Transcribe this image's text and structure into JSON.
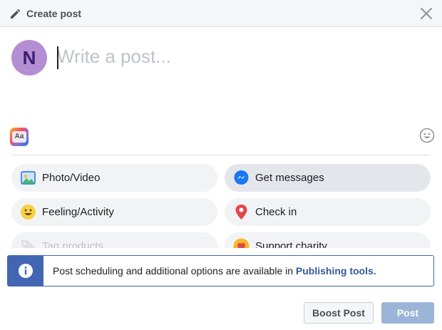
{
  "header": {
    "title": "Create post",
    "icons": {
      "left": "pencil-icon",
      "right": "close-icon"
    }
  },
  "composer": {
    "avatar_initial": "N",
    "placeholder": "Write a post...",
    "value": "",
    "icons": {
      "style": "text-background-icon",
      "emoji": "emoji-icon"
    }
  },
  "options": [
    {
      "label": "Photo/Video",
      "icon": "photo-video-icon"
    },
    {
      "label": "Get messages",
      "icon": "messenger-icon"
    },
    {
      "label": "Feeling/Activity",
      "icon": "feeling-icon"
    },
    {
      "label": "Check in",
      "icon": "check-in-pin-icon"
    },
    {
      "label": "Tag products",
      "icon": "tag-icon"
    },
    {
      "label": "Support charity",
      "icon": "charity-heart-icon"
    }
  ],
  "banner": {
    "text": "Post scheduling and additional options are available in ",
    "link": "Publishing tools.",
    "icon": "info-icon"
  },
  "footer": {
    "boost_label": "Boost Post",
    "post_label": "Post"
  },
  "colors": {
    "accent": "#4267b2",
    "link": "#365899",
    "post_button": "#9cb4d8",
    "avatar": "#b48ed2"
  }
}
